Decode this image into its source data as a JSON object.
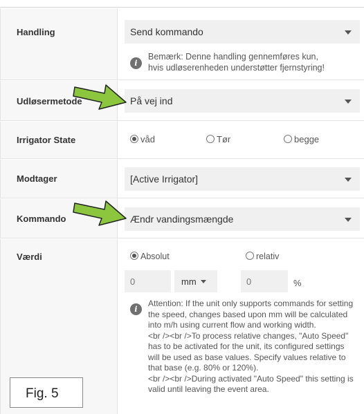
{
  "rows": {
    "handling": {
      "label": "Handling",
      "select_value": "Send kommando",
      "note": "Bemærk: Denne handling gennemføres kun, hvis udløserenheden understøtter fjernstyring!"
    },
    "udloesermetode": {
      "label": "Udløsermetode",
      "select_value": "På vej ind"
    },
    "irrigator_state": {
      "label": "Irrigator State",
      "options": [
        "våd",
        "Tør",
        "begge"
      ],
      "selected": "våd"
    },
    "modtager": {
      "label": "Modtager",
      "select_value": "[Active Irrigator]"
    },
    "kommando": {
      "label": "Kommando",
      "select_value": "Ændr vandingsmængde"
    },
    "vaerdi": {
      "label": "Værdi",
      "mode_options": [
        "Absolut",
        "relativ"
      ],
      "selected_mode": "Absolut",
      "absolute_value": "0",
      "unit": "mm",
      "relative_value": "0",
      "relative_unit": "%",
      "note_lines": [
        "Attention: If the unit only supports commands for setting",
        "the speed, changes based upon mm will be calculated",
        "into m/h using current flow and working width.",
        "<br /><br />To process relative changes, \"Auto Speed\"",
        "has to be activated for the unit, its configured settings",
        "will be used as base values. Specify values relative to",
        "that base (e.g. 80% or 120%).",
        "<br /><br />During activated \"Auto Speed\" this setting is",
        "valid until leaving the event area."
      ]
    }
  },
  "figure_label": "Fig. 5",
  "colors": {
    "arrow_fill": "#8cc63f",
    "arrow_stroke": "#222222",
    "label_bg": "#f7f7f7",
    "field_bg": "#f0f0f0"
  }
}
